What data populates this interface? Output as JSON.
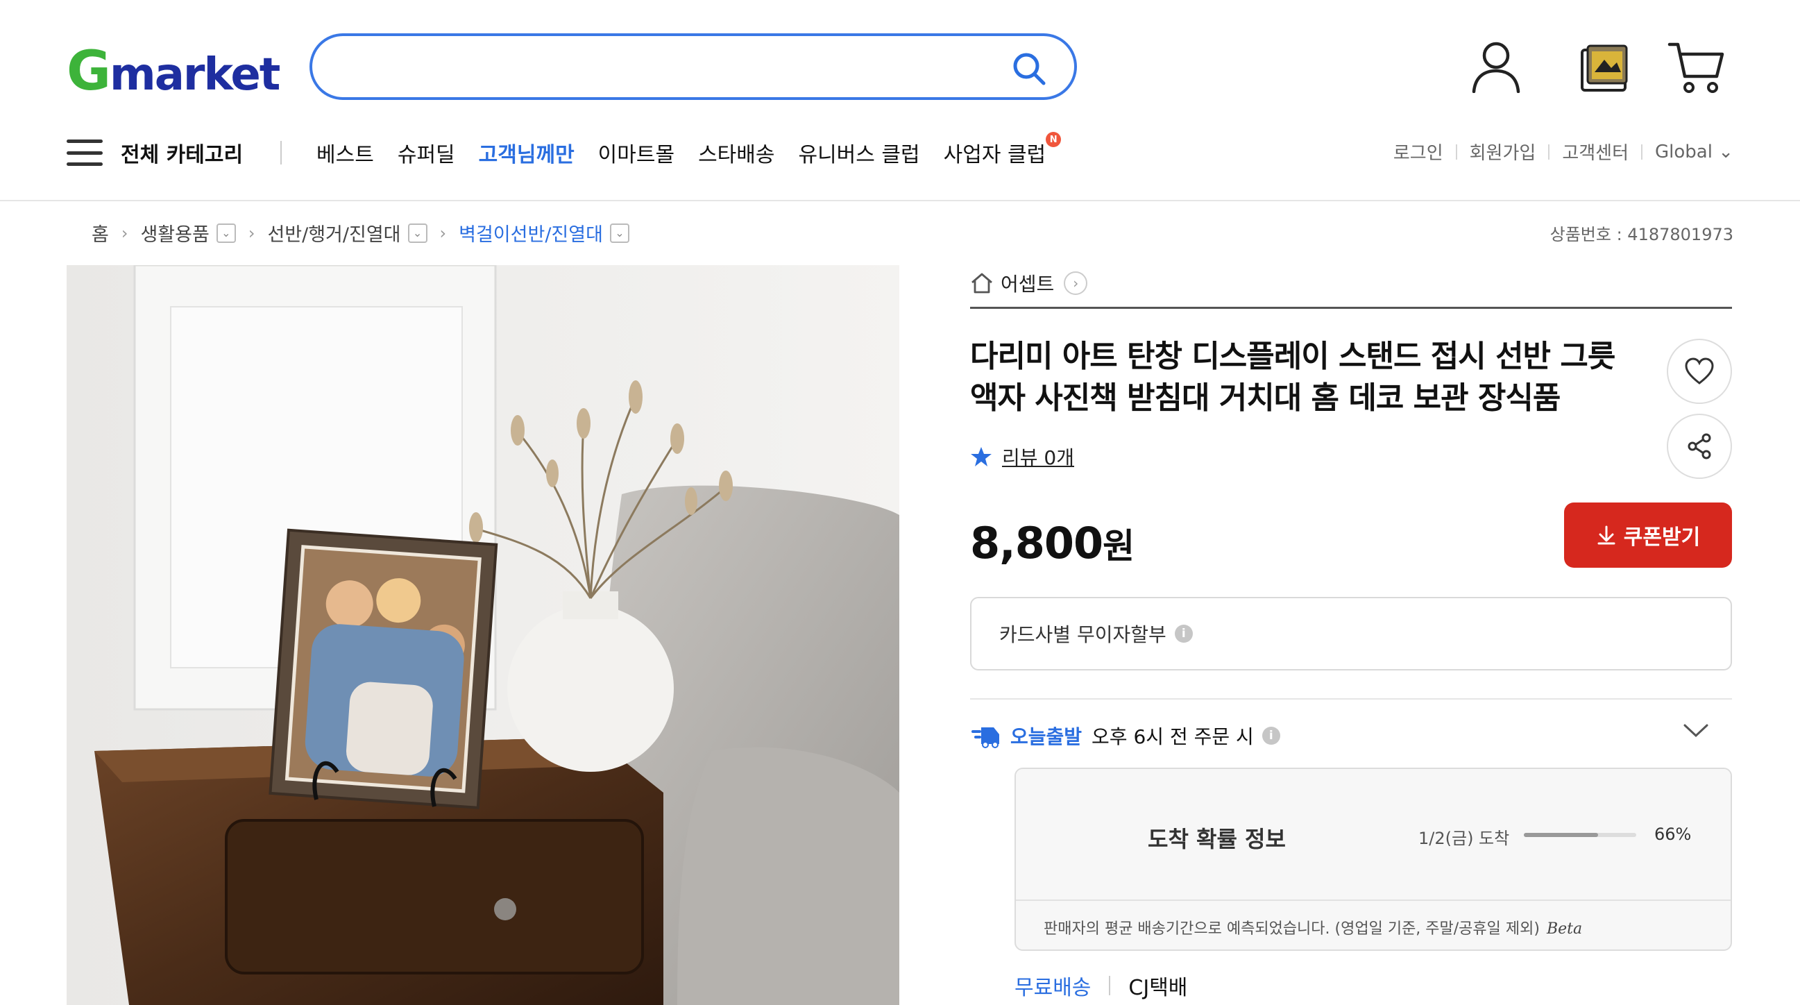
{
  "header": {
    "logo_g": "G",
    "logo_rest": "market",
    "search_placeholder": "",
    "menu_label": "전체 카테고리",
    "nav": [
      "베스트",
      "슈퍼딜",
      "고객님께만",
      "이마트몰",
      "스타배송",
      "유니버스 클럽",
      "사업자 클럽"
    ],
    "nav_badge": "N",
    "util": [
      "로그인",
      "회원가입",
      "고객센터",
      "Global ⌄"
    ]
  },
  "breadcrumb": {
    "home": "홈",
    "items": [
      "생활용품",
      "선반/행거/진열대",
      "벽걸이선반/진열대"
    ],
    "dropdown_glyph": "⌄",
    "arrow": "›"
  },
  "product": {
    "number_label": "상품번호 : 4187801973",
    "seller": "어셉트",
    "title_line1": "다리미 아트 탄창 디스플레이 스탠드 접시 선반 그릇",
    "title_line2": "액자 사진책 받침대 거치대 홈 데코 보관 장식품",
    "review": "리뷰 0개",
    "price": "8,800",
    "currency": "원",
    "coupon": "쿠폰받기",
    "installment": "카드사별 무이자할부",
    "info_glyph": "i"
  },
  "shipping": {
    "tag": "오늘출발",
    "condition": "오후 6시 전 주문 시",
    "arrival_title": "도착 확률 정보",
    "arrival_date": "1/2(금) 도착",
    "arrival_pct": "66%",
    "arrival_fraction": 0.66,
    "note": "판매자의 평균 배송기간으로 예측되었습니다. (영업일 기준, 주말/공휴일 제외)",
    "beta": "Beta",
    "free": "무료배송",
    "carrier": "CJ택배"
  },
  "colors": {
    "accent_blue": "#2a6ee0",
    "search_border": "#3a78e6",
    "coupon_red": "#d6281e",
    "logo_green": "#3db33a",
    "logo_navy": "#1e2ea0"
  }
}
